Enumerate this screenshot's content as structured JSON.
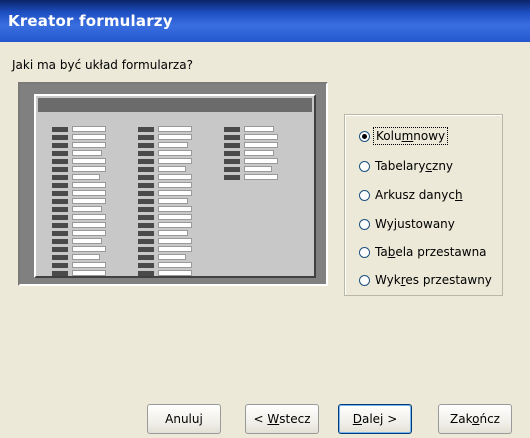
{
  "window": {
    "title": "Kreator formularzy"
  },
  "prompt": "Jaki ma być układ formularza?",
  "layout_options": [
    {
      "pre": "Kolu",
      "key": "m",
      "post": "nowy",
      "checked": true
    },
    {
      "pre": "Tabelary",
      "key": "c",
      "post": "zny",
      "checked": false
    },
    {
      "pre": "Arkusz danyc",
      "key": "h",
      "post": "",
      "checked": false
    },
    {
      "pre": "Wy",
      "key": "j",
      "post": "ustowany",
      "checked": false
    },
    {
      "pre": "Ta",
      "key": "b",
      "post": "ela przestawna",
      "checked": false
    },
    {
      "pre": "Wyk",
      "key": "r",
      "post": "es przestawny",
      "checked": false
    }
  ],
  "buttons": {
    "cancel": {
      "label": "Anuluj"
    },
    "back": {
      "pre": "< ",
      "key": "W",
      "post": "stecz"
    },
    "next": {
      "pre": "",
      "key": "D",
      "post": "alej >"
    },
    "finish": {
      "pre": "Zak",
      "key": "o",
      "post": "ńcz"
    }
  },
  "colors": {
    "accent": "#0a246a",
    "dialog_bg": "#ece9d8"
  }
}
